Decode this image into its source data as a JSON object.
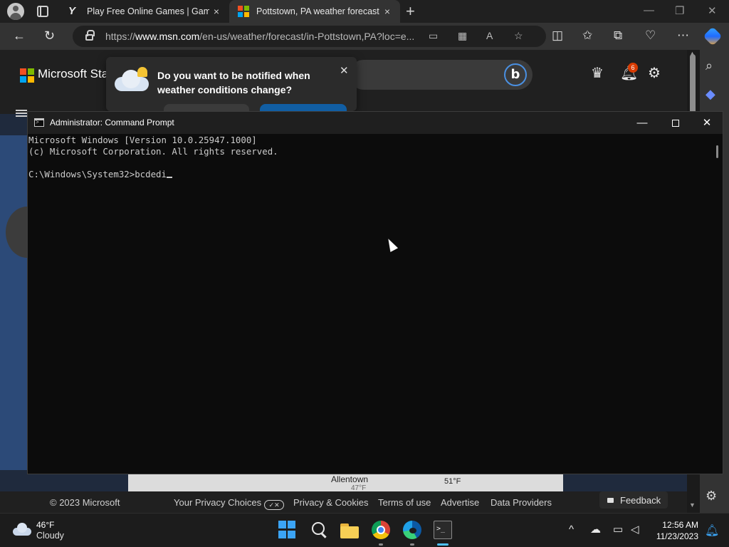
{
  "browser": {
    "tabs": [
      {
        "title": "Play Free Online Games | Games",
        "favicon": "gl-logo-icon",
        "close": "×"
      },
      {
        "title": "Pottstown, PA weather forecast |",
        "favicon": "msn-logo-icon",
        "close": "×"
      }
    ],
    "new_tab_label": "+",
    "window_controls": {
      "minimize": "—",
      "restore": "❐",
      "close": "✕"
    },
    "url_prefix": "https://",
    "url_domain": "www.msn.com",
    "url_path": "/en-us/weather/forecast/in-Pottstown,PA?loc=e...",
    "nav_glyphs": {
      "back": "←",
      "refresh": "↻",
      "more": "⋯"
    }
  },
  "msn": {
    "brand": "Microsoft Sta",
    "search_logo": "b",
    "notifications_count": "6",
    "popup": {
      "text": "Do you want to be notified when weather conditions change?",
      "close": "✕"
    },
    "map": {
      "city_a": "Allentown",
      "temp_a": "47°F",
      "temp_b": "51°F"
    },
    "footer": {
      "copyright": "© 2023 Microsoft",
      "privacy_choices": "Your Privacy Choices",
      "privacy_toggle": "✓✕",
      "privacy_cookies": "Privacy & Cookies",
      "terms": "Terms of use",
      "advertise": "Advertise",
      "data_providers": "Data Providers",
      "feedback": "Feedback"
    }
  },
  "cmd": {
    "title": "Administrator: Command Prompt",
    "lines": [
      "Microsoft Windows [Version 10.0.25947.1000]",
      "(c) Microsoft Corporation. All rights reserved.",
      "",
      "C:\\Windows\\System32>bcdedi"
    ],
    "controls": {
      "minimize": "—",
      "close": "✕"
    }
  },
  "taskbar": {
    "weather_temp": "46°F",
    "weather_desc": "Cloudy",
    "time": "12:56 AM",
    "date": "11/23/2023",
    "tray_chevron": "^"
  }
}
